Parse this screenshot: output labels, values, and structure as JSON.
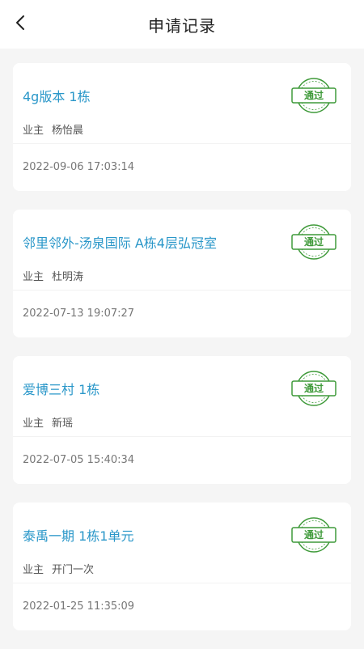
{
  "header": {
    "title": "申请记录"
  },
  "records": [
    {
      "name": "4g版本 1栋",
      "role": "业主",
      "owner": "杨怡晨",
      "time": "2022-09-06 17:03:14",
      "status": "通过"
    },
    {
      "name": "邻里邻外-汤泉国际 A栋4层弘冠室",
      "role": "业主",
      "owner": "杜明涛",
      "time": "2022-07-13 19:07:27",
      "status": "通过"
    },
    {
      "name": "爱博三村 1栋",
      "role": "业主",
      "owner": "新瑶",
      "time": "2022-07-05 15:40:34",
      "status": "通过"
    },
    {
      "name": "泰禹一期 1栋1单元",
      "role": "业主",
      "owner": "开门一次",
      "time": "2022-01-25 11:35:09",
      "status": "通过"
    }
  ],
  "colors": {
    "stamp": "#3f9a3a",
    "title_link": "#2a97c9"
  }
}
